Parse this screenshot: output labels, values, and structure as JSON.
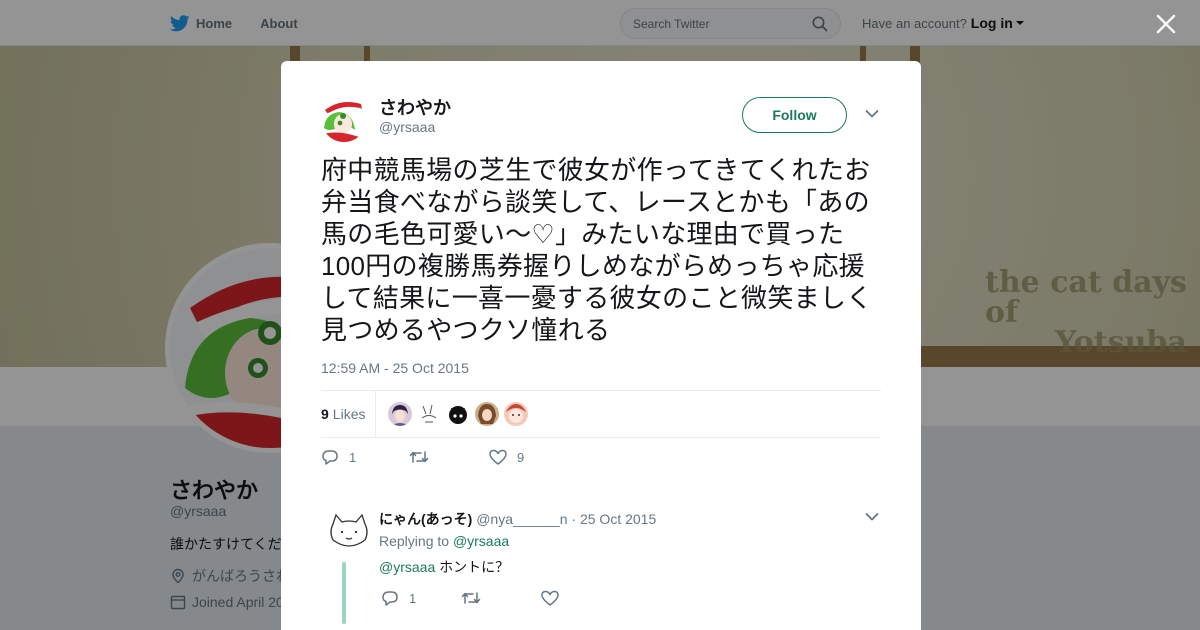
{
  "nav": {
    "home_label": "Home",
    "about_label": "About",
    "search_placeholder": "Search Twitter",
    "account_prompt": "Have an account?",
    "login_label": "Log in"
  },
  "background_profile": {
    "banner_text_line1": "the cat days of",
    "banner_text_line2": "Yotsuba",
    "name": "さわやか",
    "handle": "@yrsaaa",
    "bio": "誰かたすけてくだ",
    "location": "がんばろうさわ",
    "joined": "Joined April 20"
  },
  "tweet": {
    "author_name": "さわやか",
    "author_handle": "@yrsaaa",
    "follow_label": "Follow",
    "text": "府中競馬場の芝生で彼女が作ってきてくれたお弁当食べながら談笑して、レースとかも「あの馬の毛色可愛い～♡」みたいな理由で買った100円の複勝馬券握りしめながらめっちゃ応援して結果に一喜一憂する彼女のこと微笑ましく見つめるやつクソ憧れる",
    "timestamp": "12:59 AM - 25 Oct 2015",
    "likes_count": "9",
    "likes_label": "Likes",
    "reply_count": "1",
    "like_count_action": "9"
  },
  "reply": {
    "author_name": "にゃん(あっそ)",
    "author_handle": "@nya______n",
    "separator": "·",
    "date": "25 Oct 2015",
    "replying_prefix": "Replying to",
    "replying_to": "@yrsaaa",
    "mention": "@yrsaaa",
    "text": "ホントに？",
    "reply_count": "1"
  },
  "colors": {
    "accent": "#1b7a5a",
    "twitter_blue": "#1da1f2",
    "overlay": "rgba(0,0,0,0.42)"
  }
}
